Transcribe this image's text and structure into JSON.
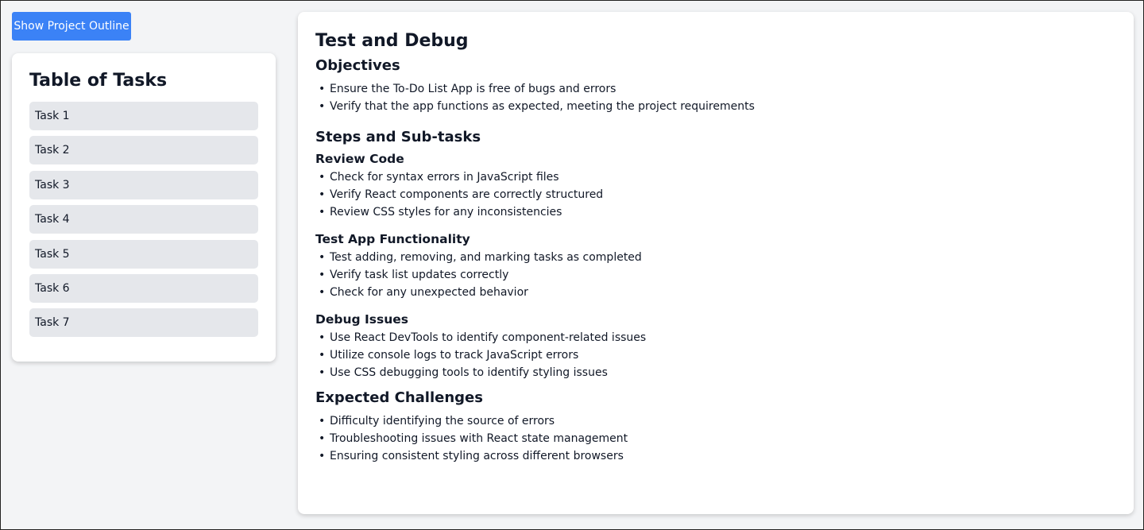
{
  "toolbar": {
    "outline_button": "Show Project Outline"
  },
  "sidebar": {
    "title": "Table of Tasks",
    "tasks": [
      "Task 1",
      "Task 2",
      "Task 3",
      "Task 4",
      "Task 5",
      "Task 6",
      "Task 7"
    ]
  },
  "main": {
    "title": "Test and Debug",
    "objectives": {
      "heading": "Objectives",
      "items": [
        "Ensure the To-Do List App is free of bugs and errors",
        "Verify that the app functions as expected, meeting the project requirements"
      ]
    },
    "steps": {
      "heading": "Steps and Sub-tasks",
      "subsections": [
        {
          "heading": "Review Code",
          "items": [
            "Check for syntax errors in JavaScript files",
            "Verify React components are correctly structured",
            "Review CSS styles for any inconsistencies"
          ]
        },
        {
          "heading": "Test App Functionality",
          "items": [
            "Test adding, removing, and marking tasks as completed",
            "Verify task list updates correctly",
            "Check for any unexpected behavior"
          ]
        },
        {
          "heading": "Debug Issues",
          "items": [
            "Use React DevTools to identify component-related issues",
            "Utilize console logs to track JavaScript errors",
            "Use CSS debugging tools to identify styling issues"
          ]
        }
      ]
    },
    "challenges": {
      "heading": "Expected Challenges",
      "items": [
        "Difficulty identifying the source of errors",
        "Troubleshooting issues with React state management",
        "Ensuring consistent styling across different browsers"
      ]
    }
  }
}
